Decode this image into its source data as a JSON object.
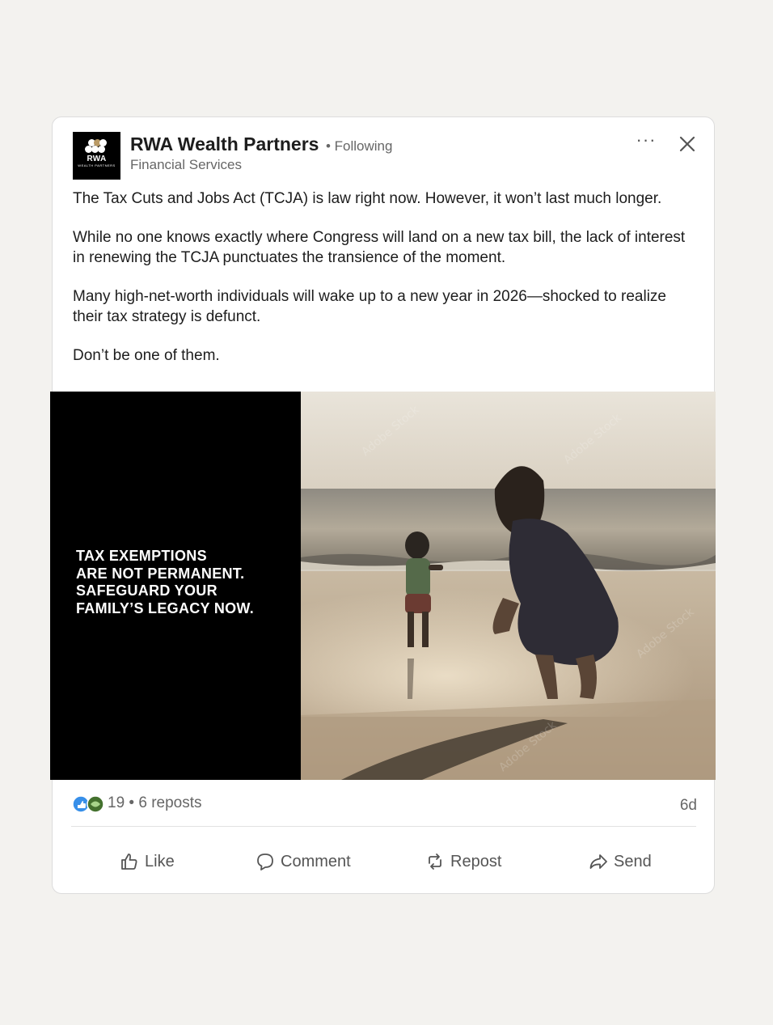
{
  "post": {
    "company_name": "RWA Wealth Partners",
    "follow_status": "• Following",
    "industry": "Financial Services",
    "logo": {
      "text": "RWA",
      "subtext": "WEALTH PARTNERS"
    },
    "more_label": "···",
    "paragraphs": [
      "The Tax Cuts and Jobs Act (TCJA) is law right now. However, it won’t last much longer.",
      "While no one knows exactly where Congress will land on a new tax bill, the lack of interest in renewing the TCJA punctuates the transience of the moment.",
      "Many high-net-worth individuals will wake up to a new year in 2026—shocked to realize their tax strategy is defunct.",
      "Don’t be one of them."
    ],
    "image": {
      "headline_lines": [
        "TAX EXEMPTIONS",
        "ARE NOT PERMANENT.",
        "SAFEGUARD YOUR",
        "FAMILY’S LEGACY NOW."
      ]
    },
    "social": {
      "reaction_count": "19",
      "reposts": "• 6 reposts",
      "time_ago": "6d"
    },
    "actions": {
      "like": "Like",
      "comment": "Comment",
      "repost": "Repost",
      "send": "Send"
    }
  },
  "colors": {
    "background": "#f3f2ef",
    "card": "#ffffff",
    "text": "#1d1d1d",
    "muted": "#666666",
    "logo_accent": "#b99a66"
  },
  "icons": {
    "more": "ellipsis-icon",
    "close": "close-icon",
    "like": "thumbs-up-icon",
    "comment": "comment-bubble-icon",
    "repost": "repost-arrows-icon",
    "send": "send-arrow-icon"
  }
}
